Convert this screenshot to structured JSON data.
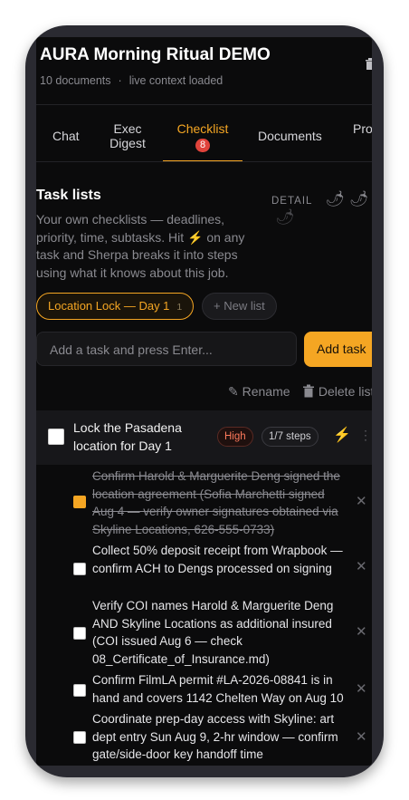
{
  "header": {
    "title": "AURA Morning Ritual DEMO",
    "doc_count": "10 documents",
    "separator": "·",
    "context_status": "live context loaded"
  },
  "tabs": [
    {
      "label": "Chat"
    },
    {
      "label": "Exec Digest"
    },
    {
      "label": "Checklist",
      "badge": "8",
      "active": true
    },
    {
      "label": "Documents"
    },
    {
      "label": "Pro"
    }
  ],
  "task_lists": {
    "heading": "Task lists",
    "detail_label": "DETAIL",
    "detail_level_icons": [
      "chili-icon",
      "chili-icon",
      "chili-icon"
    ],
    "description_1": "Your own checklists — deadlines, priority, time, subtasks. Hit",
    "description_icon": "⚡",
    "description_2": "on any task and Sherpa breaks it into steps using what it knows about this job.",
    "active_list": {
      "label": "Location Lock — Day 1",
      "count": "1"
    },
    "new_list_label": "+ New list",
    "input_placeholder": "Add a task and press Enter...",
    "add_task_label": "Add task",
    "rename_label": "Rename",
    "delete_list_label": "Delete list"
  },
  "task": {
    "title": "Lock the Pasadena location for Day 1",
    "priority": "High",
    "steps": "1/7 steps",
    "steps_items": [
      {
        "text": "Confirm Harold & Marguerite Deng signed the location agreement (Sofia Marchetti signed Aug 4 — verify owner signatures obtained via Skyline Locations, 626-555-0733)",
        "done": true
      },
      {
        "text": "Collect 50% deposit receipt from Wrapbook — confirm ACH to Dengs processed on signing",
        "done": false
      },
      {
        "text": "Verify COI names Harold & Marguerite Deng AND Skyline Locations as additional insured (COI issued Aug 6 — check 08_Certificate_of_Insurance.md)",
        "done": false
      },
      {
        "text": "Confirm FilmLA permit #LA-2026-08841 is in hand and covers 1142 Chelten Way on Aug 10",
        "done": false
      },
      {
        "text": "Coordinate prep-day access with Skyline: art dept entry Sun Aug 9, 2-hr window — confirm gate/side-door key handoff time",
        "done": false
      }
    ]
  },
  "colors": {
    "accent": "#f5a623",
    "background": "#0b0b0c",
    "badge_red": "#e0433b",
    "high_priority": "#ff7a5c"
  }
}
